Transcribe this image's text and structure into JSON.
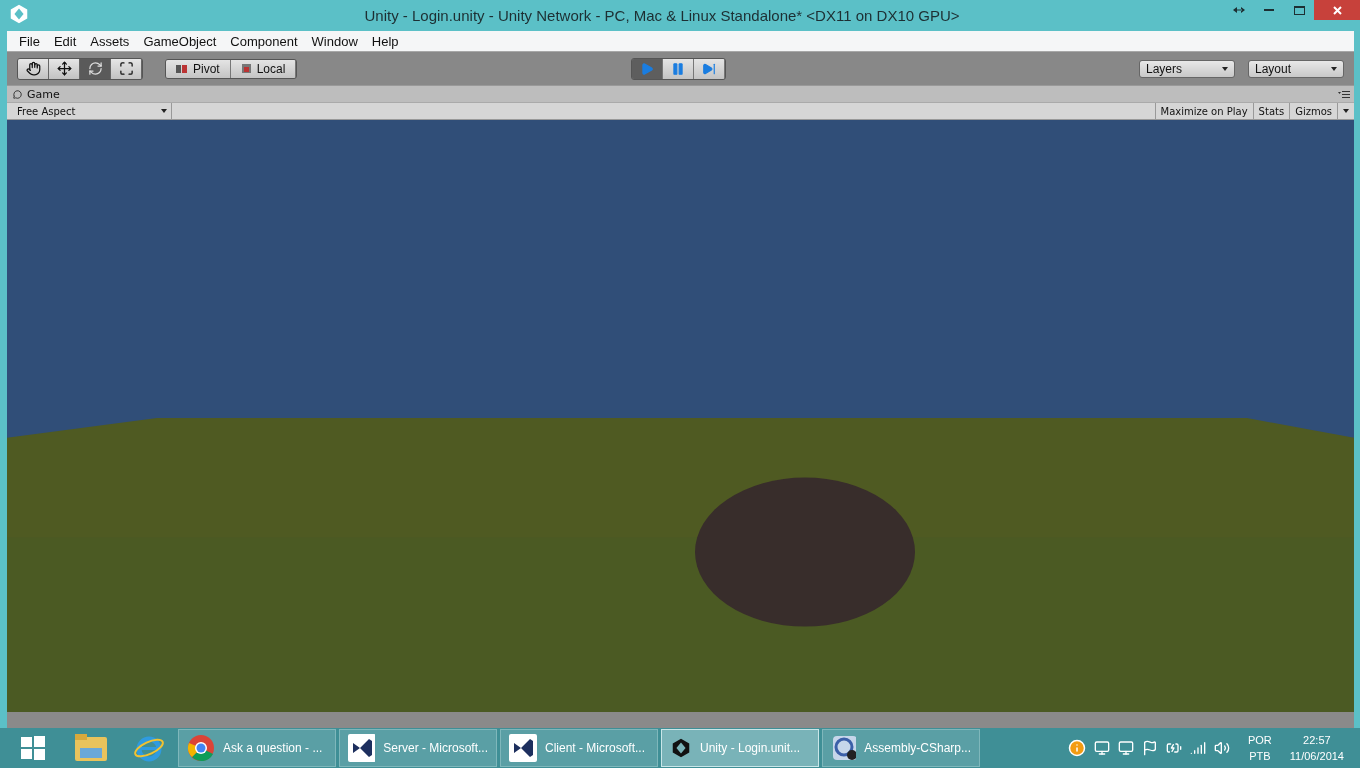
{
  "window": {
    "title": "Unity - Login.unity - Unity Network - PC, Mac & Linux Standalone* <DX11 on DX10 GPU>"
  },
  "menu": [
    "File",
    "Edit",
    "Assets",
    "GameObject",
    "Component",
    "Window",
    "Help"
  ],
  "tools": [
    {
      "kind": "hand",
      "selected": false
    },
    {
      "kind": "move",
      "selected": false
    },
    {
      "kind": "rotate",
      "selected": true
    },
    {
      "kind": "scale",
      "selected": false
    }
  ],
  "pivot_buttons": [
    {
      "kind": "pivot",
      "label": "Pivot"
    },
    {
      "kind": "local",
      "label": "Local"
    }
  ],
  "play_controls": [
    {
      "kind": "play",
      "selected": true
    },
    {
      "kind": "pause",
      "selected": false
    },
    {
      "kind": "step",
      "selected": false
    }
  ],
  "dropdowns": [
    "Layers",
    "Layout"
  ],
  "game_panel": {
    "tab": "Game",
    "aspect": "Free Aspect",
    "buttons": [
      "Maximize on Play",
      "Stats",
      "Gizmos"
    ]
  },
  "taskbar": {
    "pinned": [
      {
        "kind": "start"
      },
      {
        "kind": "folder"
      },
      {
        "kind": "browser"
      }
    ],
    "tasks": [
      {
        "kind": "chrome",
        "label": "Ask a question - ...",
        "selected": false
      },
      {
        "kind": "vs",
        "label": "Server - Microsoft...",
        "selected": false
      },
      {
        "kind": "vs",
        "label": "Client - Microsoft...",
        "selected": false
      },
      {
        "kind": "unity",
        "label": "Unity - Login.unit...",
        "selected": true
      },
      {
        "kind": "assembly",
        "label": "Assembly-CSharp...",
        "selected": false
      }
    ],
    "language": [
      "POR",
      "PTB"
    ],
    "time": "22:57",
    "date": "11/06/2014"
  }
}
